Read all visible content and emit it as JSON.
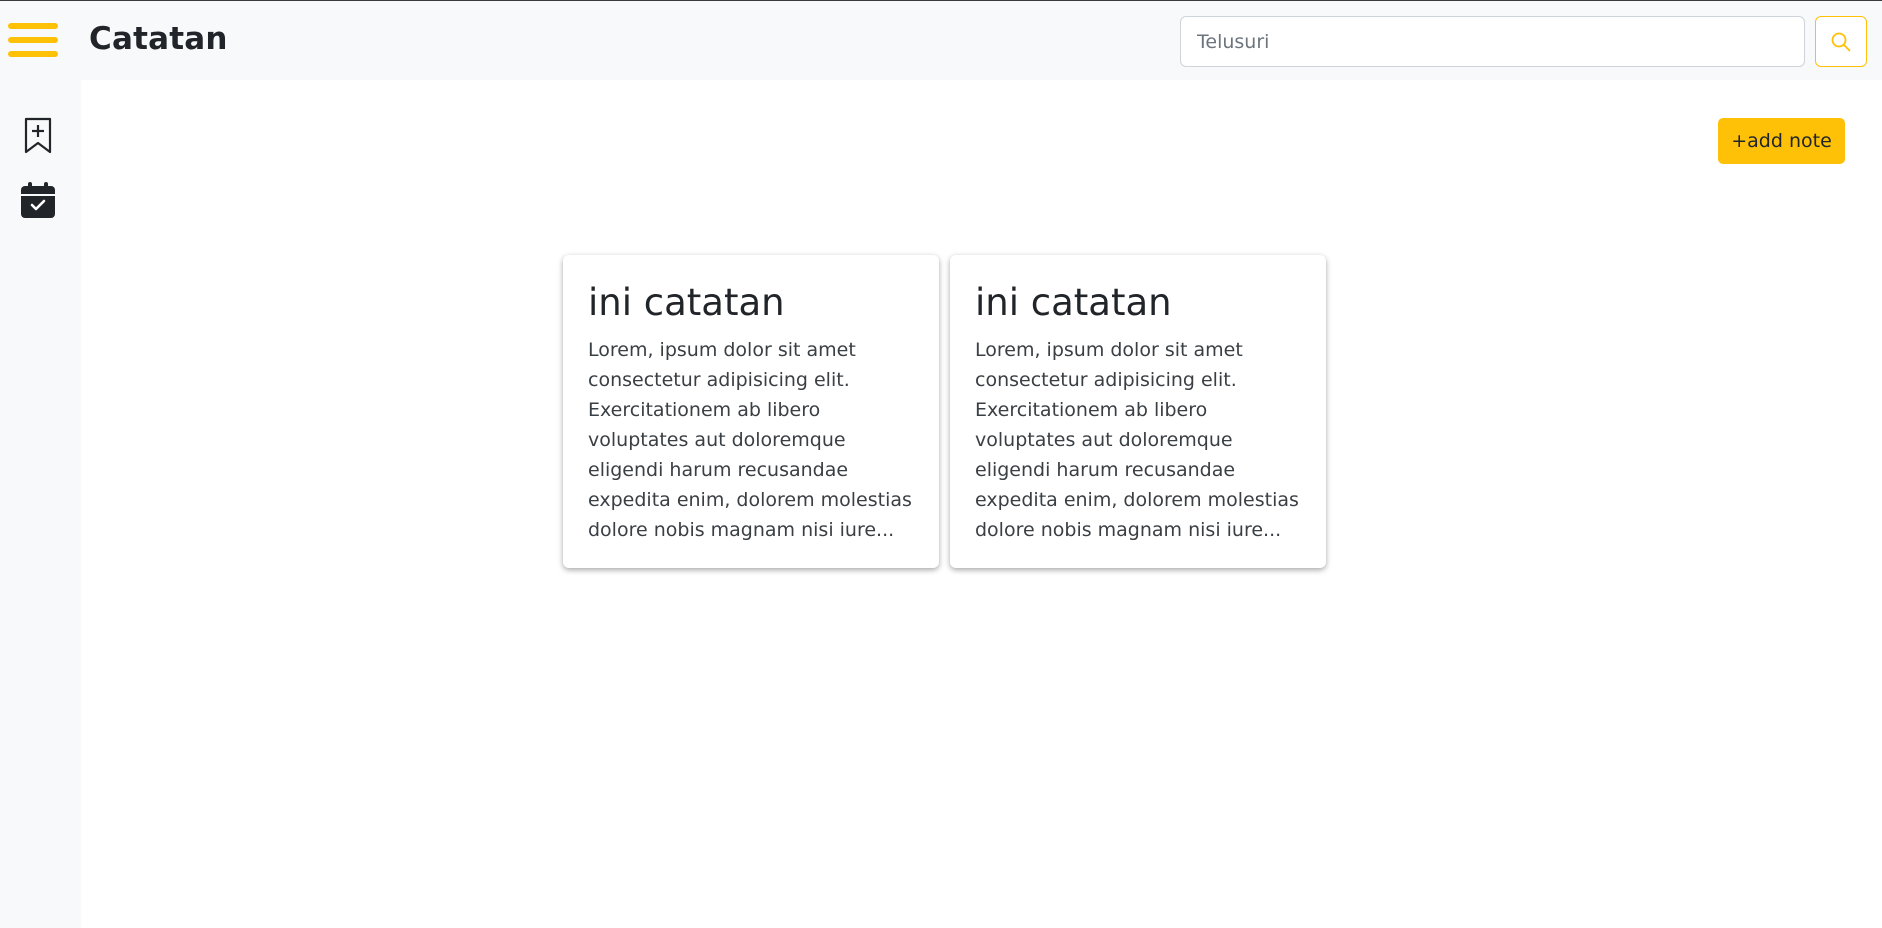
{
  "header": {
    "brand": "Catatan",
    "search_placeholder": "Telusuri",
    "menu_icon": "hamburger-icon",
    "search_icon": "search-icon"
  },
  "sidebar": {
    "items": [
      {
        "icon": "bookmark-plus-icon"
      },
      {
        "icon": "calendar-check-icon"
      }
    ]
  },
  "main": {
    "add_note_label": "+add note",
    "notes": [
      {
        "title": "ini catatan",
        "body": "Lorem, ipsum dolor sit amet consectetur adipisicing elit. Exercitationem ab libero voluptates aut doloremque eligendi harum recusandae expedita enim, dolorem molestias dolore nobis magnam nisi iure..."
      },
      {
        "title": "ini catatan",
        "body": "Lorem, ipsum dolor sit amet consectetur adipisicing elit. Exercitationem ab libero voluptates aut doloremque eligendi harum recusandae expedita enim, dolorem molestias dolore nobis magnam nisi iure..."
      }
    ]
  },
  "colors": {
    "accent": "#ffc107",
    "topbar_bg": "#f8f9fa",
    "text": "#212529"
  }
}
